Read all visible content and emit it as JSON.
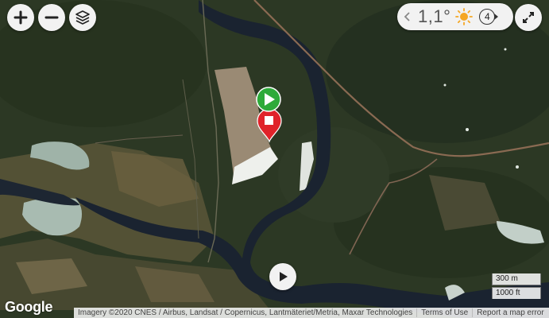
{
  "map": {
    "type": "satellite",
    "markers": [
      {
        "name": "start",
        "color": "#2eaa3a",
        "icon": "play-icon"
      },
      {
        "name": "finish",
        "color": "#e0232a",
        "icon": "stop-icon"
      }
    ]
  },
  "controls": {
    "zoom_in": "plus-icon",
    "zoom_out": "minus-icon",
    "layers": "layers-icon",
    "fullscreen": "expand-icon",
    "play": "play-icon"
  },
  "weather": {
    "temperature": "1,1°",
    "condition_icon": "sun-icon",
    "sun_color": "#f5a623",
    "wind_force": "4"
  },
  "scale": {
    "metric": "300 m",
    "imperial": "1000 ft"
  },
  "footer": {
    "logo": "Google",
    "imagery": "Imagery ©2020 CNES / Airbus, Landsat / Copernicus, Lantmäteriet/Metria, Maxar Technologies",
    "terms": "Terms of Use",
    "report": "Report a map error"
  }
}
